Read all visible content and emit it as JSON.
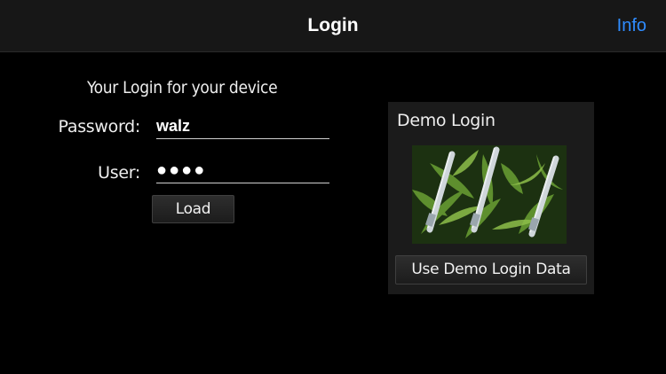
{
  "nav": {
    "title": "Login",
    "info_label": "Info"
  },
  "form": {
    "heading": "Your Login for your device",
    "password_label": "Password:",
    "password_value": "walz",
    "user_label": "User:",
    "user_value": "●●●●",
    "load_label": "Load"
  },
  "demo": {
    "title": "Demo Login",
    "image_icon": "plant-sensor-photo",
    "button_label": "Use Demo Login Data"
  },
  "colors": {
    "accent": "#2f8cff",
    "background": "#000000",
    "navbar": "#171717",
    "panel": "#1b1b1b"
  }
}
